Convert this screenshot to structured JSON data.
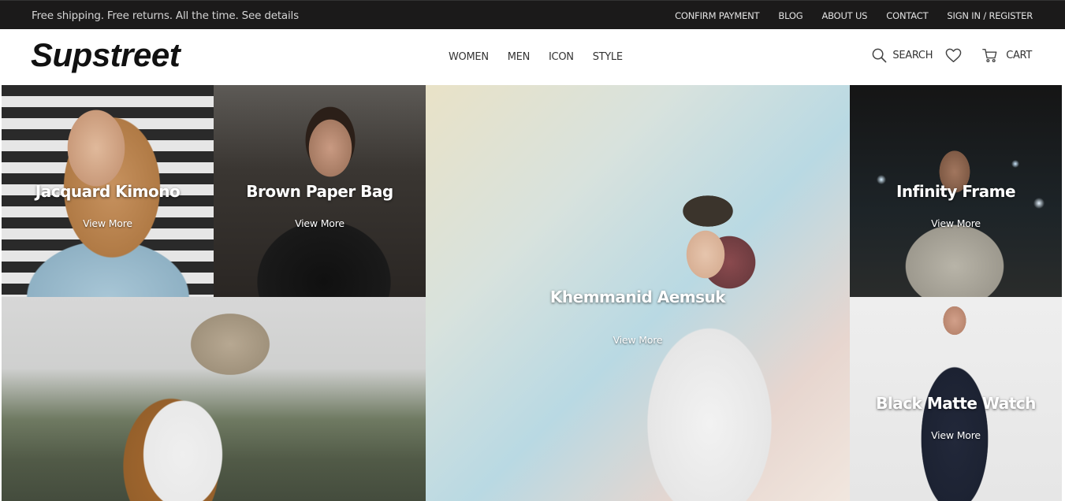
{
  "topbar": {
    "promo": "Free shipping. Free returns. All the time. See details",
    "links": [
      "CONFIRM PAYMENT",
      "BLOG",
      "ABOUT US",
      "CONTACT",
      "SIGN IN / REGISTER"
    ]
  },
  "header": {
    "logo": "Supstreet",
    "nav": [
      "WOMEN",
      "MEN",
      "ICON",
      "STYLE"
    ],
    "search_label": "SEARCH",
    "cart_label": "CART"
  },
  "tiles": [
    {
      "title": "Jacquard Kimono",
      "cta": "View More"
    },
    {
      "title": "Brown Paper Bag",
      "cta": "View More"
    },
    {
      "title": "Khemmanid Aemsuk",
      "cta": "View More"
    },
    {
      "title": "Infinity Frame",
      "cta": "View More"
    },
    {
      "title": "",
      "cta": ""
    },
    {
      "title": "Black Matte Watch",
      "cta": "View More"
    }
  ],
  "icons": {
    "search": "search-icon",
    "wishlist": "heart-icon",
    "cart": "cart-icon"
  }
}
